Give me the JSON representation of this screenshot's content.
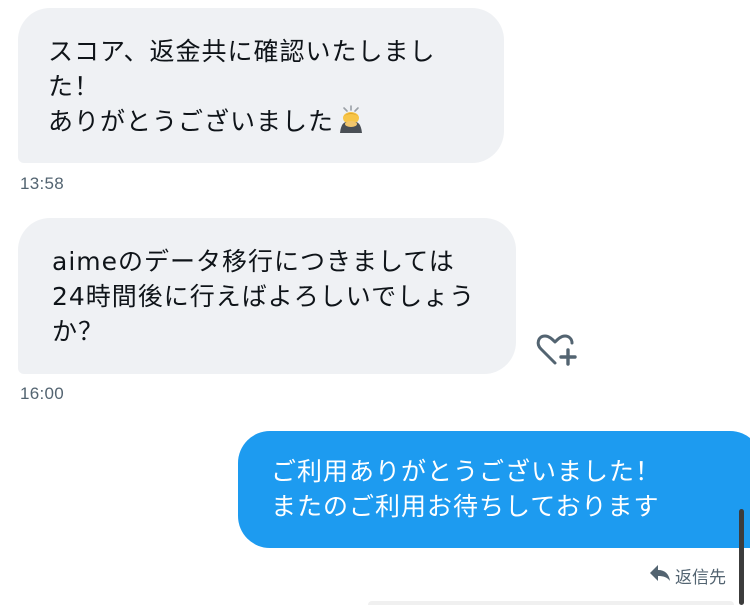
{
  "messages": [
    {
      "direction": "incoming",
      "text": "スコア、返金共に確認いたしました！\nありがとうございました",
      "emoji": "person-bowing-emoji",
      "time": "13:58"
    },
    {
      "direction": "incoming",
      "text": "aimeのデータ移行につきましては24時間後に行えばよろしいでしょうか？",
      "time": "16:00"
    },
    {
      "direction": "outgoing",
      "text": "ご利用ありがとうございました！\nまたのご利用お待ちしております"
    }
  ],
  "actions": {
    "like_icon": "heart-plus-icon",
    "reply_icon": "reply-arrow-icon",
    "reply_label": "返信先"
  },
  "colors": {
    "incoming_bubble": "#eff1f4",
    "outgoing_bubble": "#1d9bf0",
    "secondary_text": "#536471"
  }
}
